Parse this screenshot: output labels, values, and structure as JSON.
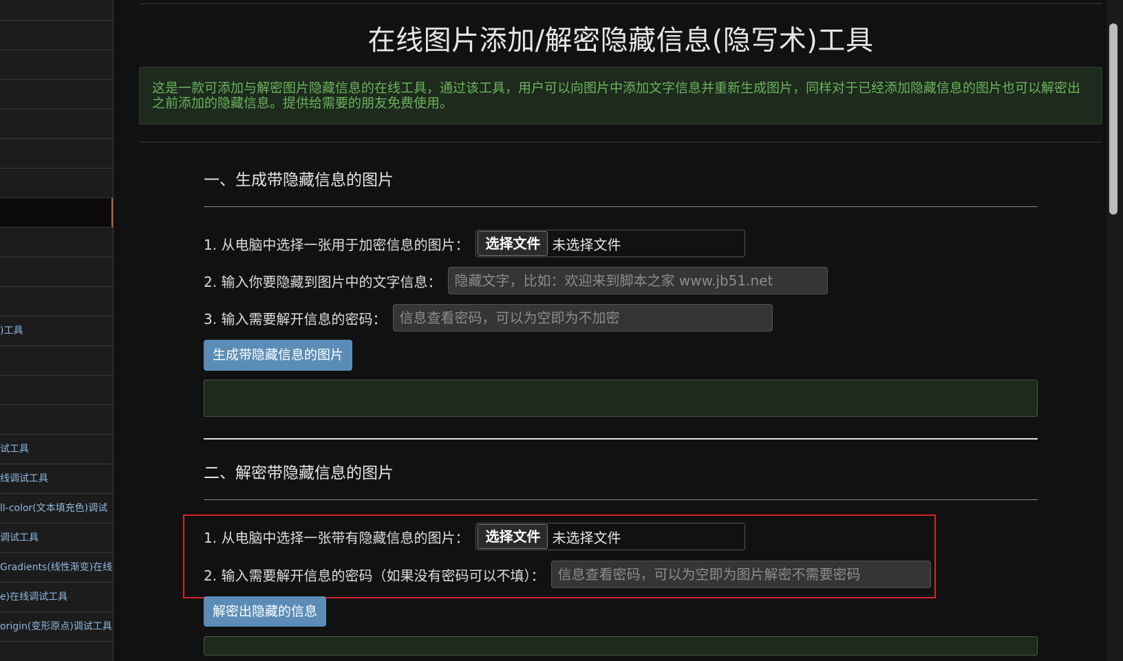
{
  "sidebar": {
    "items": [
      {
        "label": ""
      },
      {
        "label": ""
      },
      {
        "label": ""
      },
      {
        "label": ""
      },
      {
        "label": ""
      },
      {
        "label": ""
      },
      {
        "label": "",
        "active": true
      },
      {
        "label": ""
      },
      {
        "label": ""
      },
      {
        "label": ""
      },
      {
        "label": ")工具"
      },
      {
        "label": ""
      },
      {
        "label": ""
      },
      {
        "label": ""
      },
      {
        "label": "试工具"
      },
      {
        "label": "线调试工具"
      },
      {
        "label": "ll-color(文本填充色)调试"
      },
      {
        "label": "调试工具"
      },
      {
        "label": "Gradients(线性渐变)在线"
      },
      {
        "label": "e)在线调试工具"
      },
      {
        "label": "origin(变形原点)调试工具"
      }
    ]
  },
  "page": {
    "title": "在线图片添加/解密隐藏信息(隐写术)工具",
    "notice": "这是一款可添加与解密图片隐藏信息的在线工具，通过该工具，用户可以向图片中添加文字信息并重新生成图片，同样对于已经添加隐藏信息的图片也可以解密出之前添加的隐藏信息。提供给需要的朋友免费使用。"
  },
  "encode": {
    "heading": "一、生成带隐藏信息的图片",
    "file_label": "1. 从电脑中选择一张用于加密信息的图片：",
    "file_button": "选择文件",
    "file_status": "未选择文件",
    "text_label": "2. 输入你要隐藏到图片中的文字信息：",
    "text_placeholder": "隐藏文字，比如：欢迎来到脚本之家 www.jb51.net",
    "password_label": "3. 输入需要解开信息的密码：",
    "password_placeholder": "信息查看密码，可以为空即为不加密",
    "submit_label": "生成带隐藏信息的图片"
  },
  "decode": {
    "heading": "二、解密带隐藏信息的图片",
    "file_label": "1. 从电脑中选择一张带有隐藏信息的图片：",
    "file_button": "选择文件",
    "file_status": "未选择文件",
    "password_label": "2. 输入需要解开信息的密码（如果没有密码可以不填）：",
    "password_placeholder": "信息查看密码，可以为空即为图片解密不需要密码",
    "submit_label": "解密出隐藏的信息"
  },
  "colors": {
    "accent_button": "#5b8db8",
    "notice_text": "#6bb35a",
    "highlight_border": "#d8232a"
  }
}
